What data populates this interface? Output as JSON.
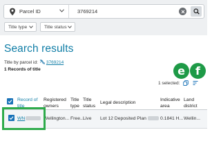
{
  "search": {
    "type_label": "Parcel ID",
    "value": "3769214"
  },
  "filters": [
    {
      "label": "Title type"
    },
    {
      "label": "Title status"
    }
  ],
  "results": {
    "title": "Search results",
    "subtitle_prefix": "Title by parcel id:",
    "parcel_link": "3769214",
    "count_label": "1 Records of title",
    "selected_label": "1 selected:"
  },
  "badges": {
    "e": "e",
    "f": "f"
  },
  "table": {
    "columns": [
      {
        "label": "Record of title"
      },
      {
        "label": "Registered owners"
      },
      {
        "label": "Title type"
      },
      {
        "label": "Title status"
      },
      {
        "label": "Legal description"
      },
      {
        "label": "Indicative area"
      },
      {
        "label": "Land district"
      }
    ],
    "rows": [
      {
        "record": "WN",
        "owners": "Wellington...",
        "type": "Free...",
        "status": "Live",
        "legal": "Lot 12 Deposited Plan",
        "area": "0.1841 H...",
        "district": "Wellin..."
      }
    ]
  },
  "colors": {
    "accent": "#0f7da6",
    "badge_green": "#1e9a47",
    "highlight_green": "#2eab4b",
    "checkbox_blue": "#1a73b8"
  }
}
